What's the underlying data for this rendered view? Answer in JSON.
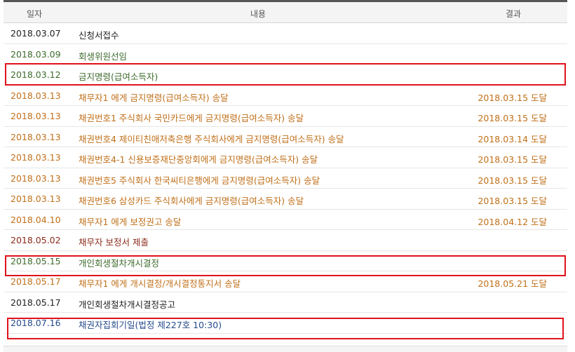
{
  "columns": {
    "date": "일자",
    "content": "내용",
    "result": "결과"
  },
  "colors": {
    "highlight": "#e0121b",
    "header_bg": "#f4f4f4"
  },
  "rows": [
    {
      "date": "2018.03.07",
      "content": "신청서접수",
      "result": "",
      "color": "black"
    },
    {
      "date": "2018.03.09",
      "content": "회생위원선임",
      "result": "",
      "color": "green"
    },
    {
      "date": "2018.03.12",
      "content": "금지명령(급여소득자)",
      "result": "",
      "color": "green"
    },
    {
      "date": "2018.03.13",
      "content": "채무자1          에게 금지명령(급여소득자) 송달",
      "result": "2018.03.15 도달",
      "color": "orange"
    },
    {
      "date": "2018.03.13",
      "content": "채권번호1 주식회사 국민카드에게 금지명령(급여소득자) 송달",
      "result": "2018.03.15 도달",
      "color": "orange"
    },
    {
      "date": "2018.03.13",
      "content": "채권번호4 제이티친애저축은행 주식회사에게 금지명령(급여소득자) 송달",
      "result": "2018.03.14 도달",
      "color": "orange"
    },
    {
      "date": "2018.03.13",
      "content": "채권번호4-1 신용보증재단중앙회에게 금지명령(급여소득자) 송달",
      "result": "2018.03.15 도달",
      "color": "orange"
    },
    {
      "date": "2018.03.13",
      "content": "채권번호5 주식회사 한국씨티은행에게 금지명령(급여소득자) 송달",
      "result": "2018.03.15 도달",
      "color": "orange"
    },
    {
      "date": "2018.03.13",
      "content": "채권번호6 삼성카드 주식회사에게 금지명령(급여소득자) 송달",
      "result": "2018.03.15 도달",
      "color": "orange"
    },
    {
      "date": "2018.04.10",
      "content": "채무자1          에게 보정권고 송달",
      "result": "2018.04.12 도달",
      "color": "orange"
    },
    {
      "date": "2018.05.02",
      "content": "채무자          보정서 제출",
      "result": "",
      "color": "dred"
    },
    {
      "date": "2018.05.15",
      "content": "개인회생절차개시결정",
      "result": "",
      "color": "green"
    },
    {
      "date": "2018.05.17",
      "content": "채무자1          에게 개시결정/개시결정통지서 송달",
      "result": "2018.05.21 도달",
      "color": "orange"
    },
    {
      "date": "2018.05.17",
      "content": "개인회생절차개시결정공고",
      "result": "",
      "color": "black"
    },
    {
      "date": "2018.07.16",
      "content": "채권자집회기일(법정 제227호 10:30)",
      "result": "",
      "color": "blue"
    }
  ]
}
